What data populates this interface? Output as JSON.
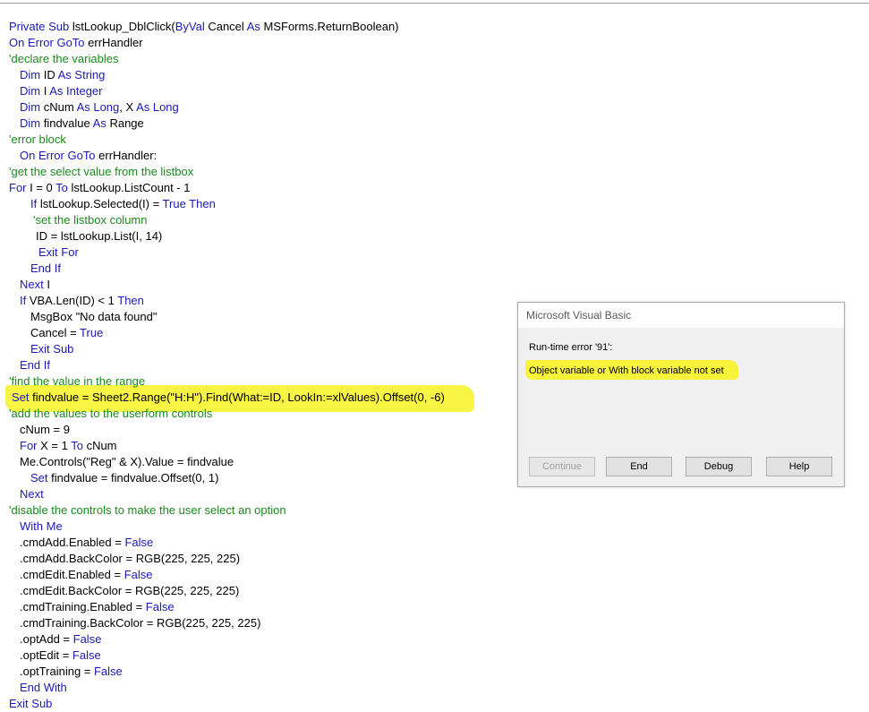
{
  "code_lines": [
    {
      "indent": 10,
      "tokens": [
        {
          "k": "kw",
          "t": "Private Sub "
        },
        {
          "k": "tx",
          "t": "lstLookup_DblClick("
        },
        {
          "k": "kw",
          "t": "ByVal "
        },
        {
          "k": "tx",
          "t": "Cancel "
        },
        {
          "k": "kw",
          "t": "As "
        },
        {
          "k": "tx",
          "t": "MSForms.ReturnBoolean)"
        }
      ]
    },
    {
      "indent": 10,
      "tokens": [
        {
          "k": "kw",
          "t": "On Error GoTo "
        },
        {
          "k": "tx",
          "t": "errHandler"
        }
      ]
    },
    {
      "indent": 10,
      "tokens": [
        {
          "k": "cm",
          "t": "'declare the variables"
        }
      ]
    },
    {
      "indent": 22,
      "tokens": [
        {
          "k": "kw",
          "t": "Dim "
        },
        {
          "k": "tx",
          "t": "ID "
        },
        {
          "k": "kw",
          "t": "As String"
        }
      ]
    },
    {
      "indent": 22,
      "tokens": [
        {
          "k": "kw",
          "t": "Dim "
        },
        {
          "k": "tx",
          "t": "I "
        },
        {
          "k": "kw",
          "t": "As Integer"
        }
      ]
    },
    {
      "indent": 22,
      "tokens": [
        {
          "k": "kw",
          "t": "Dim "
        },
        {
          "k": "tx",
          "t": "cNum "
        },
        {
          "k": "kw",
          "t": "As Long"
        },
        {
          "k": "tx",
          "t": ", X "
        },
        {
          "k": "kw",
          "t": "As Long"
        }
      ]
    },
    {
      "indent": 22,
      "tokens": [
        {
          "k": "kw",
          "t": "Dim "
        },
        {
          "k": "tx",
          "t": "findvalue "
        },
        {
          "k": "kw",
          "t": "As "
        },
        {
          "k": "tx",
          "t": "Range"
        }
      ]
    },
    {
      "indent": 10,
      "tokens": [
        {
          "k": "cm",
          "t": "'error block"
        }
      ]
    },
    {
      "indent": 22,
      "tokens": [
        {
          "k": "kw",
          "t": "On Error GoTo "
        },
        {
          "k": "tx",
          "t": "errHandler:"
        }
      ]
    },
    {
      "indent": 10,
      "tokens": [
        {
          "k": "cm",
          "t": "'get the select value from the listbox"
        }
      ]
    },
    {
      "indent": 10,
      "tokens": [
        {
          "k": "kw",
          "t": "For "
        },
        {
          "k": "tx",
          "t": "I = 0 "
        },
        {
          "k": "kw",
          "t": "To "
        },
        {
          "k": "tx",
          "t": "lstLookup.ListCount - 1"
        }
      ]
    },
    {
      "indent": 34,
      "tokens": [
        {
          "k": "kw",
          "t": "If "
        },
        {
          "k": "tx",
          "t": "lstLookup.Selected(I) = "
        },
        {
          "k": "kw",
          "t": "True Then"
        }
      ]
    },
    {
      "indent": 37,
      "tokens": [
        {
          "k": "cm",
          "t": "'set the listbox column"
        }
      ]
    },
    {
      "indent": 40,
      "tokens": [
        {
          "k": "tx",
          "t": "ID = lstLookup.List(I, 14)"
        }
      ]
    },
    {
      "indent": 43,
      "tokens": [
        {
          "k": "kw",
          "t": "Exit For"
        }
      ]
    },
    {
      "indent": 34,
      "tokens": [
        {
          "k": "kw",
          "t": "End If"
        }
      ]
    },
    {
      "indent": 22,
      "tokens": [
        {
          "k": "kw",
          "t": "Next "
        },
        {
          "k": "tx",
          "t": "I"
        }
      ]
    },
    {
      "indent": 22,
      "tokens": [
        {
          "k": "kw",
          "t": "If "
        },
        {
          "k": "tx",
          "t": "VBA.Len(ID) < 1 "
        },
        {
          "k": "kw",
          "t": "Then"
        }
      ]
    },
    {
      "indent": 34,
      "tokens": [
        {
          "k": "tx",
          "t": "MsgBox \"No data found\""
        }
      ]
    },
    {
      "indent": 34,
      "tokens": [
        {
          "k": "tx",
          "t": "Cancel = "
        },
        {
          "k": "kw",
          "t": "True"
        }
      ]
    },
    {
      "indent": 34,
      "tokens": [
        {
          "k": "kw",
          "t": "Exit Sub"
        }
      ]
    },
    {
      "indent": 22,
      "tokens": [
        {
          "k": "kw",
          "t": "End If"
        }
      ]
    },
    {
      "indent": 10,
      "tokens": [
        {
          "k": "cm",
          "t": "'find the value in the range"
        }
      ]
    },
    {
      "indent": 13,
      "tokens": [
        {
          "k": "kw",
          "t": "Set "
        },
        {
          "k": "tx",
          "t": "findvalue = Sheet2.Range(\"H:H\").Find(What:=ID, LookIn:=xlValues).Offset(0, -6)"
        }
      ]
    },
    {
      "indent": 10,
      "tokens": [
        {
          "k": "cm",
          "t": "'add the values to the userform controls"
        }
      ]
    },
    {
      "indent": 22,
      "tokens": [
        {
          "k": "tx",
          "t": "cNum = 9"
        }
      ]
    },
    {
      "indent": 22,
      "tokens": [
        {
          "k": "kw",
          "t": "For "
        },
        {
          "k": "tx",
          "t": "X = 1 "
        },
        {
          "k": "kw",
          "t": "To "
        },
        {
          "k": "tx",
          "t": "cNum"
        }
      ]
    },
    {
      "indent": 22,
      "tokens": [
        {
          "k": "tx",
          "t": "Me.Controls(\"Reg\" & X).Value = findvalue"
        }
      ]
    },
    {
      "indent": 34,
      "tokens": [
        {
          "k": "kw",
          "t": "Set "
        },
        {
          "k": "tx",
          "t": "findvalue = findvalue.Offset(0, 1)"
        }
      ]
    },
    {
      "indent": 22,
      "tokens": [
        {
          "k": "kw",
          "t": "Next"
        }
      ]
    },
    {
      "indent": 10,
      "tokens": [
        {
          "k": "cm",
          "t": "'disable the controls to make the user select an option"
        }
      ]
    },
    {
      "indent": 22,
      "tokens": [
        {
          "k": "kw",
          "t": "With Me"
        }
      ]
    },
    {
      "indent": 22,
      "tokens": [
        {
          "k": "tx",
          "t": ".cmdAdd.Enabled = "
        },
        {
          "k": "kw",
          "t": "False"
        }
      ]
    },
    {
      "indent": 22,
      "tokens": [
        {
          "k": "tx",
          "t": ".cmdAdd.BackColor = RGB(225, 225, 225)"
        }
      ]
    },
    {
      "indent": 22,
      "tokens": [
        {
          "k": "tx",
          "t": ".cmdEdit.Enabled = "
        },
        {
          "k": "kw",
          "t": "False"
        }
      ]
    },
    {
      "indent": 22,
      "tokens": [
        {
          "k": "tx",
          "t": ".cmdEdit.BackColor = RGB(225, 225, 225)"
        }
      ]
    },
    {
      "indent": 22,
      "tokens": [
        {
          "k": "tx",
          "t": ".cmdTraining.Enabled = "
        },
        {
          "k": "kw",
          "t": "False"
        }
      ]
    },
    {
      "indent": 22,
      "tokens": [
        {
          "k": "tx",
          "t": ".cmdTraining.BackColor = RGB(225, 225, 225)"
        }
      ]
    },
    {
      "indent": 22,
      "tokens": [
        {
          "k": "tx",
          "t": ".optAdd = "
        },
        {
          "k": "kw",
          "t": "False"
        }
      ]
    },
    {
      "indent": 22,
      "tokens": [
        {
          "k": "tx",
          "t": ".optEdit = "
        },
        {
          "k": "kw",
          "t": "False"
        }
      ]
    },
    {
      "indent": 22,
      "tokens": [
        {
          "k": "tx",
          "t": ".optTraining = "
        },
        {
          "k": "kw",
          "t": "False"
        }
      ]
    },
    {
      "indent": 22,
      "tokens": [
        {
          "k": "kw",
          "t": "End With"
        }
      ]
    },
    {
      "indent": 10,
      "tokens": [
        {
          "k": "kw",
          "t": "Exit Sub"
        }
      ]
    }
  ],
  "dialog": {
    "title": "Microsoft Visual Basic",
    "error_title": "Run-time error '91':",
    "message": "Object variable or With block variable not set",
    "buttons": {
      "continue": "Continue",
      "end": "End",
      "debug": "Debug",
      "help": "Help"
    }
  },
  "colors": {
    "keyword": "#1a1ab8",
    "comment": "#1a8a1a",
    "highlight": "#f7f33a"
  }
}
